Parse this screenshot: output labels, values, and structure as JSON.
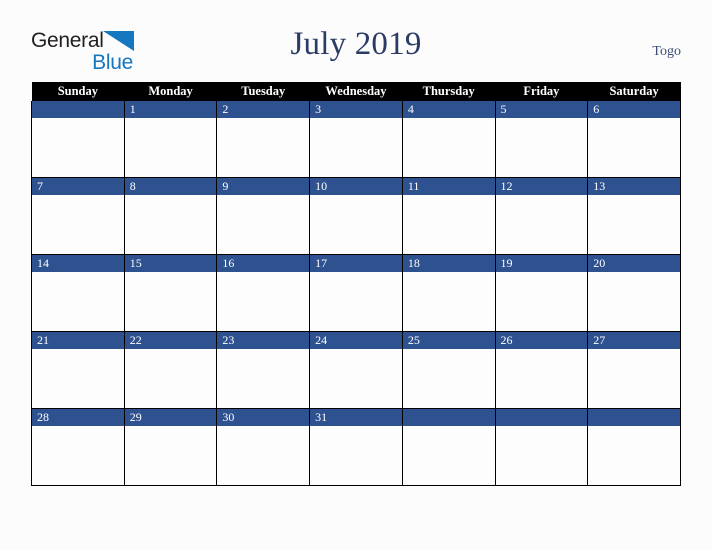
{
  "brand": {
    "name_part1": "General",
    "name_part2": "Blue",
    "triangle_color": "#1577bf"
  },
  "header": {
    "title": "July 2019",
    "region": "Togo"
  },
  "calendar": {
    "weekday_headers": [
      "Sunday",
      "Monday",
      "Tuesday",
      "Wednesday",
      "Thursday",
      "Friday",
      "Saturday"
    ],
    "accent_color": "#2e5190",
    "header_background": "#000000",
    "weeks": [
      [
        "",
        "1",
        "2",
        "3",
        "4",
        "5",
        "6"
      ],
      [
        "7",
        "8",
        "9",
        "10",
        "11",
        "12",
        "13"
      ],
      [
        "14",
        "15",
        "16",
        "17",
        "18",
        "19",
        "20"
      ],
      [
        "21",
        "22",
        "23",
        "24",
        "25",
        "26",
        "27"
      ],
      [
        "28",
        "29",
        "30",
        "31",
        "",
        "",
        ""
      ]
    ]
  }
}
